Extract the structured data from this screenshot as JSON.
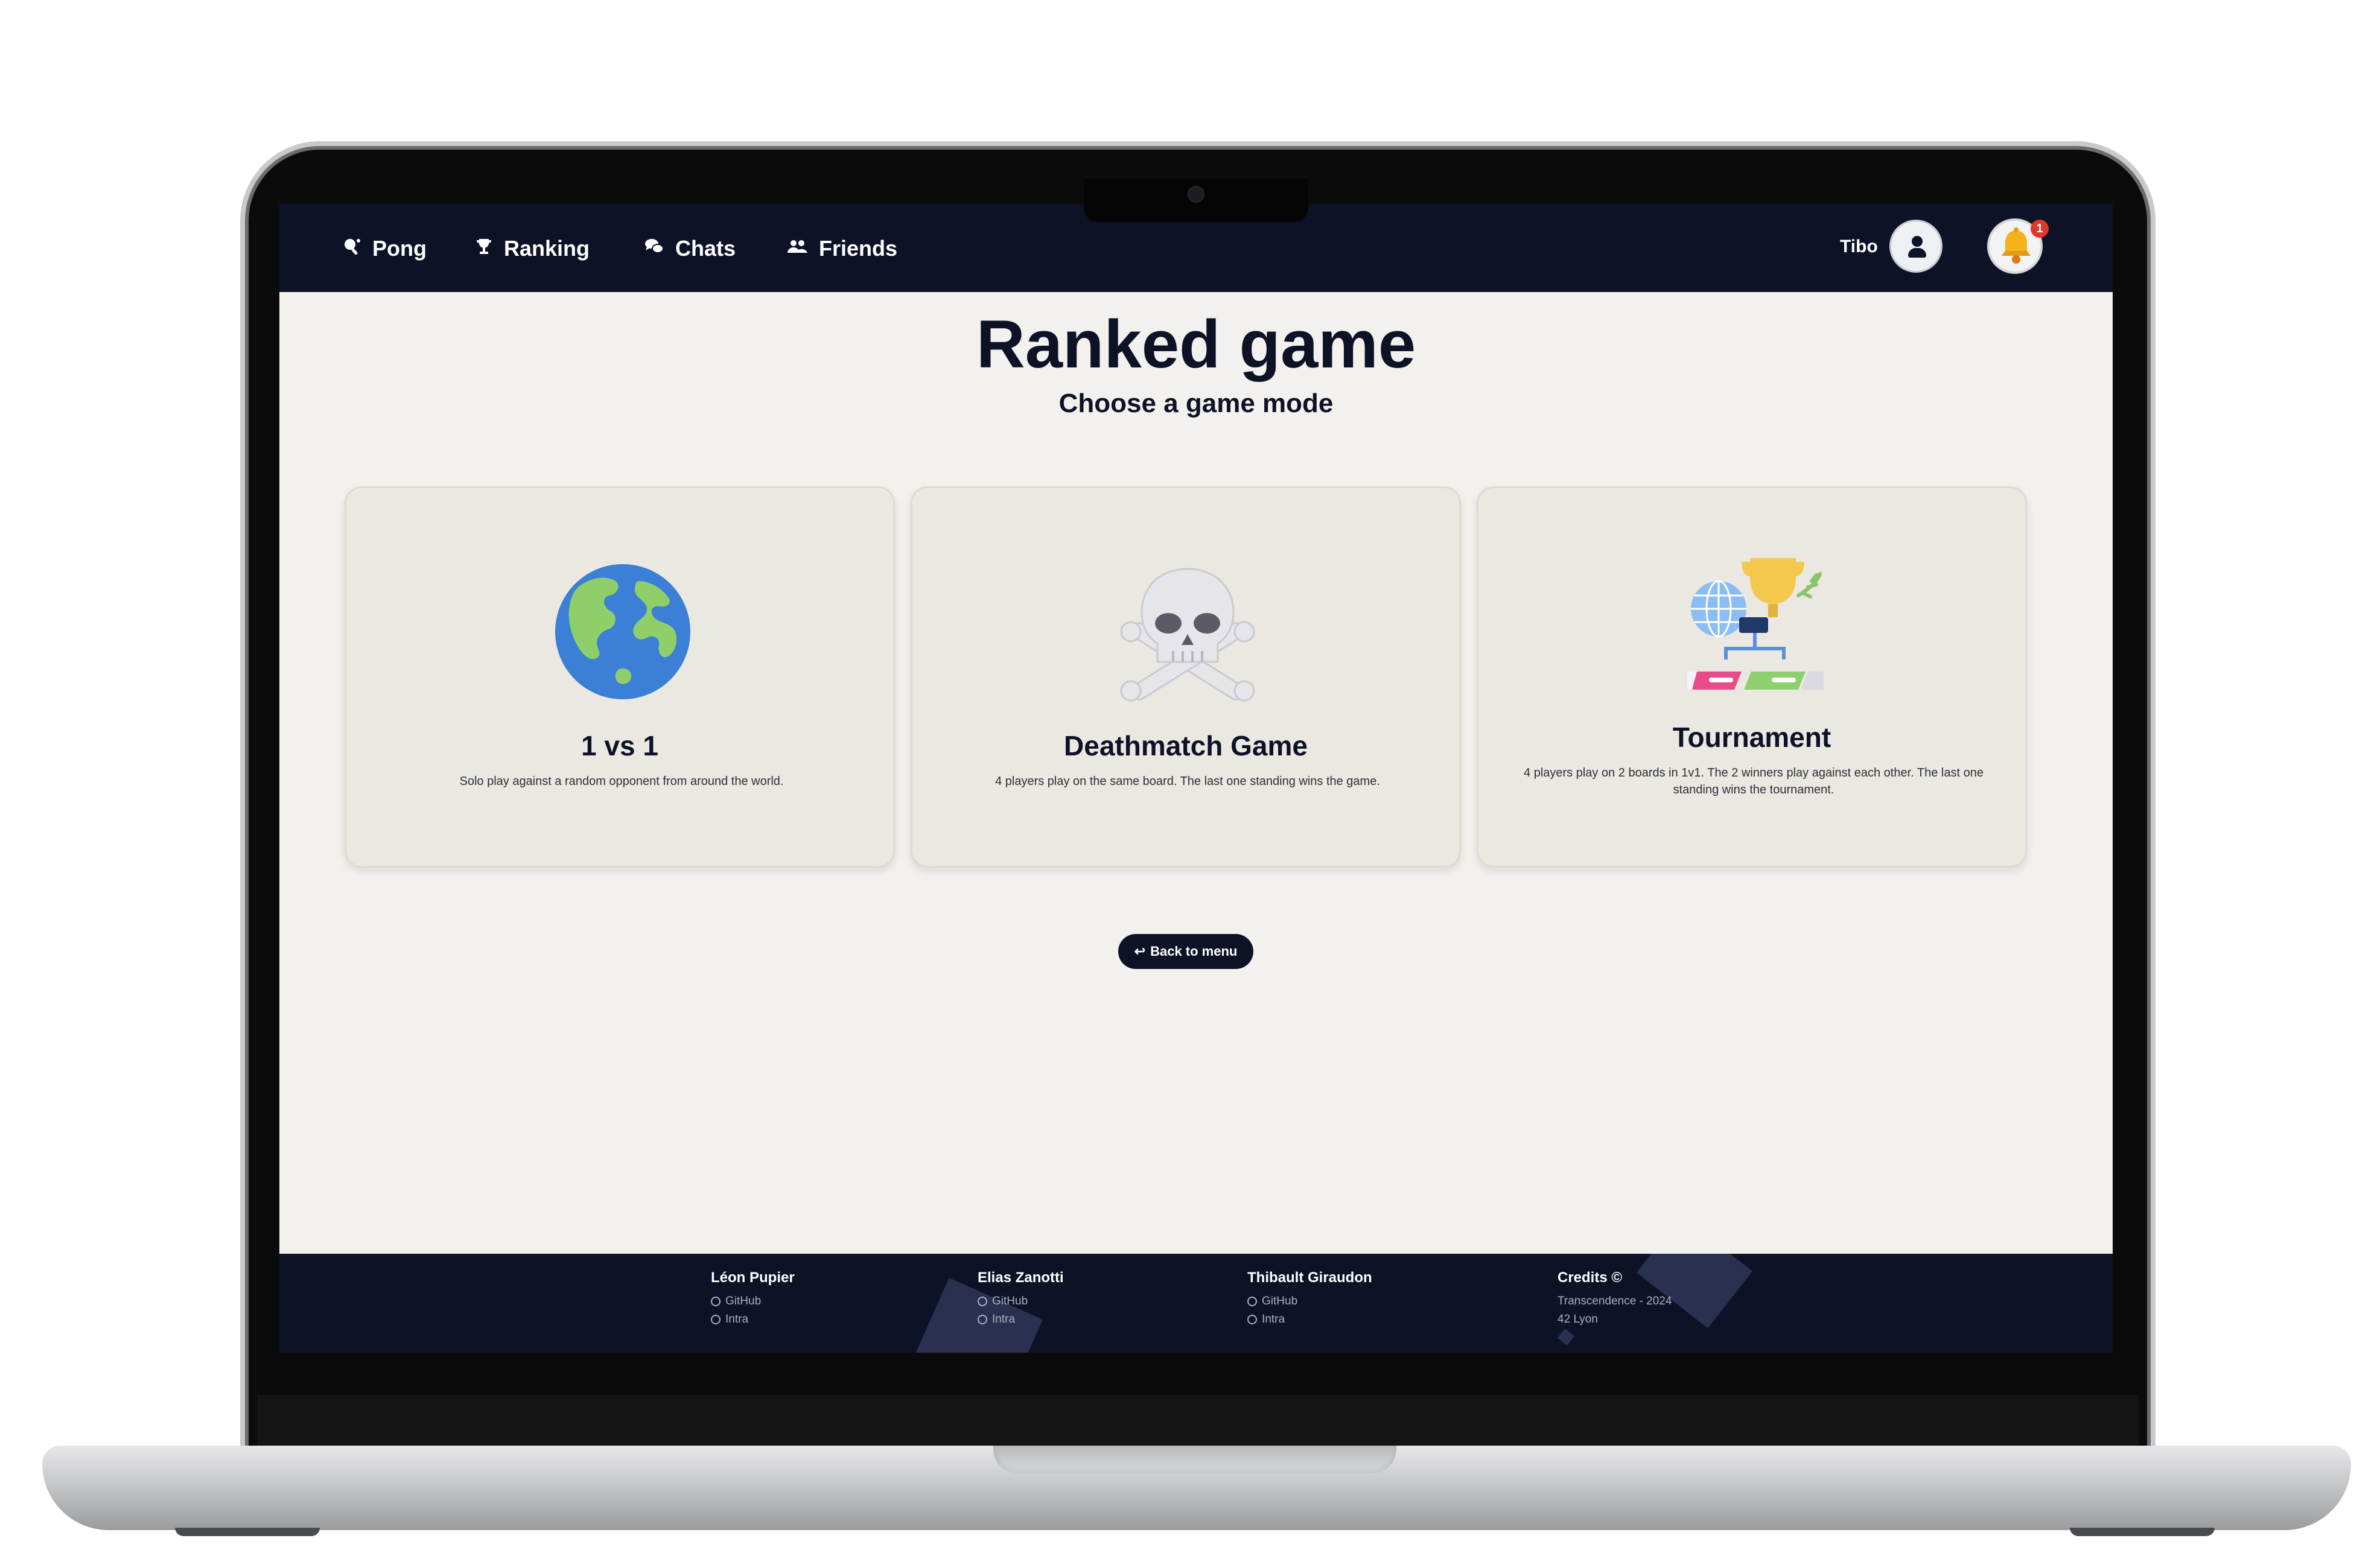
{
  "navbar": {
    "items": [
      {
        "label": "Pong",
        "icon": "ping-pong-icon"
      },
      {
        "label": "Ranking",
        "icon": "trophy-icon"
      },
      {
        "label": "Chats",
        "icon": "chat-bubbles-icon"
      },
      {
        "label": "Friends",
        "icon": "users-icon"
      }
    ],
    "user_name": "Tibo",
    "notification_count": "1"
  },
  "page": {
    "title": "Ranked game",
    "subtitle": "Choose a game mode"
  },
  "modes": [
    {
      "title": "1 vs 1",
      "description": "Solo play against a random opponent from around the world.",
      "icon": "globe-icon"
    },
    {
      "title": "Deathmatch Game",
      "description": "4 players play on the same board. The last one standing wins the game.",
      "icon": "skull-crossbones-icon"
    },
    {
      "title": "Tournament",
      "description": "4 players play on 2 boards in 1v1. The 2 winners play against each other. The last one standing wins the tournament.",
      "icon": "tournament-bracket-icon"
    }
  ],
  "back_button": {
    "arrow": "↩",
    "label": "Back to menu"
  },
  "footer": {
    "authors": [
      {
        "name": "Léon Pupier",
        "links": [
          "GitHub",
          "Intra"
        ]
      },
      {
        "name": "Elias Zanotti",
        "links": [
          "GitHub",
          "Intra"
        ]
      },
      {
        "name": "Thibault Giraudon",
        "links": [
          "GitHub",
          "Intra"
        ]
      }
    ],
    "credits": {
      "title": "Credits ©",
      "lines": [
        "Transcendence - 2024",
        "42 Lyon"
      ]
    }
  },
  "colors": {
    "navy": "#0d1227",
    "background": "#f2f1ee",
    "card": "#ebe8e2",
    "badge": "#e0362b"
  }
}
